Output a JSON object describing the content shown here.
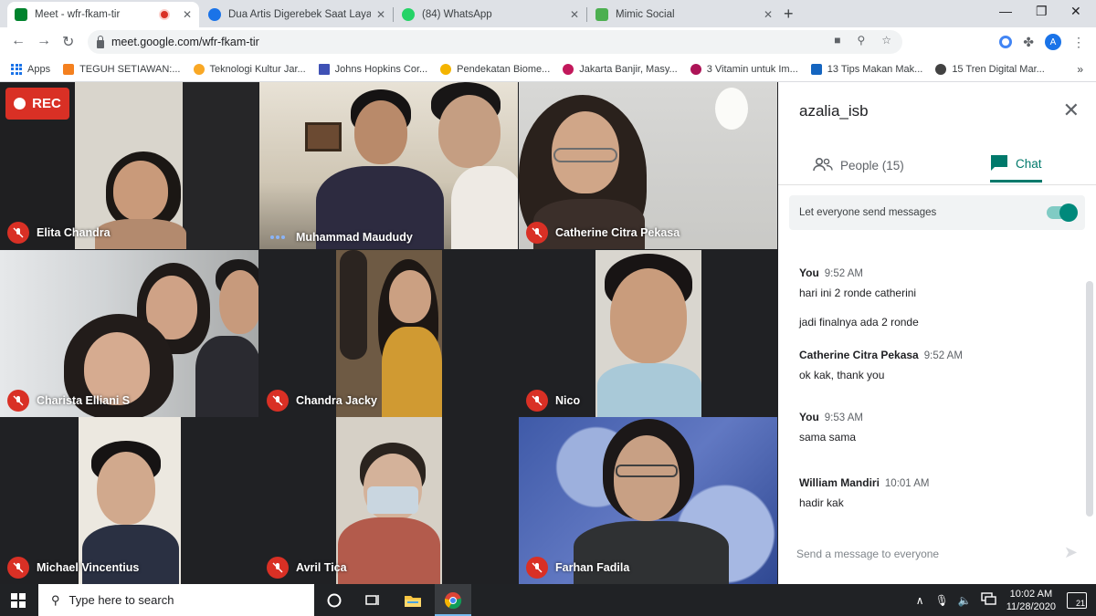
{
  "browser": {
    "tabs": [
      {
        "title": "Meet - wfr-fkam-tir",
        "favicon_color": "#00832d",
        "recording": true
      },
      {
        "title": "Dua Artis Digerebek Saat Layan",
        "favicon_color": "#1a73e8"
      },
      {
        "title": "(84) WhatsApp",
        "favicon_color": "#25d366"
      },
      {
        "title": "Mimic Social",
        "favicon_color": "#4caf50"
      }
    ],
    "new_tab_icon": "plus-icon",
    "url": "meet.google.com/wfr-fkam-tir",
    "profile_initial": "A"
  },
  "bookmarks": [
    {
      "label": "Apps",
      "icon": "apps-grid-icon",
      "color": "#1a73e8"
    },
    {
      "label": "TEGUH SETIAWAN:...",
      "color": "#f4801f"
    },
    {
      "label": "Teknologi Kultur Jar...",
      "color": "#f9a825"
    },
    {
      "label": "Johns Hopkins Cor...",
      "color": "#3f51b5"
    },
    {
      "label": "Pendekatan Biome...",
      "color": "#f4b400"
    },
    {
      "label": "Jakarta Banjir, Masy...",
      "color": "#c2185b"
    },
    {
      "label": "3 Vitamin untuk Im...",
      "color": "#ad1457"
    },
    {
      "label": "13 Tips Makan Mak...",
      "color": "#1565c0"
    },
    {
      "label": "15 Tren Digital Mar...",
      "color": "#424242"
    }
  ],
  "meet": {
    "rec_label": "REC",
    "participants": [
      {
        "name": "Elita Chandra",
        "status": "muted"
      },
      {
        "name": "Muhammad Maududy",
        "status": "speaking"
      },
      {
        "name": "Catherine Citra Pekasa",
        "status": "muted"
      },
      {
        "name": "Charista Elliani S",
        "status": "muted"
      },
      {
        "name": "Chandra Jacky",
        "status": "muted"
      },
      {
        "name": "Nico",
        "status": "muted"
      },
      {
        "name": "Michael Vincentius",
        "status": "muted"
      },
      {
        "name": "Avril Tica",
        "status": "muted"
      },
      {
        "name": "Farhan Fadila",
        "status": "muted"
      }
    ]
  },
  "chat_panel": {
    "title": "azalia_isb",
    "tabs": {
      "people": "People (15)",
      "chat": "Chat"
    },
    "setting_label": "Let everyone send messages",
    "setting_on": true,
    "messages": [
      {
        "sender": "You",
        "time": "9:52 AM",
        "lines": [
          "hari ini 2 ronde catherini",
          "jadi finalnya ada 2 ronde"
        ]
      },
      {
        "sender": "Catherine Citra Pekasa",
        "time": "9:52 AM",
        "lines": [
          "ok kak, thank you"
        ]
      },
      {
        "sender": "You",
        "time": "9:53 AM",
        "lines": [
          "sama sama"
        ]
      },
      {
        "sender": "William Mandiri",
        "time": "10:01 AM",
        "lines": [
          "hadir kak"
        ]
      }
    ],
    "input_placeholder": "Send a message to everyone"
  },
  "taskbar": {
    "search_placeholder": "Type here to search",
    "time": "10:02 AM",
    "date": "11/28/2020",
    "notification_count": "21"
  }
}
